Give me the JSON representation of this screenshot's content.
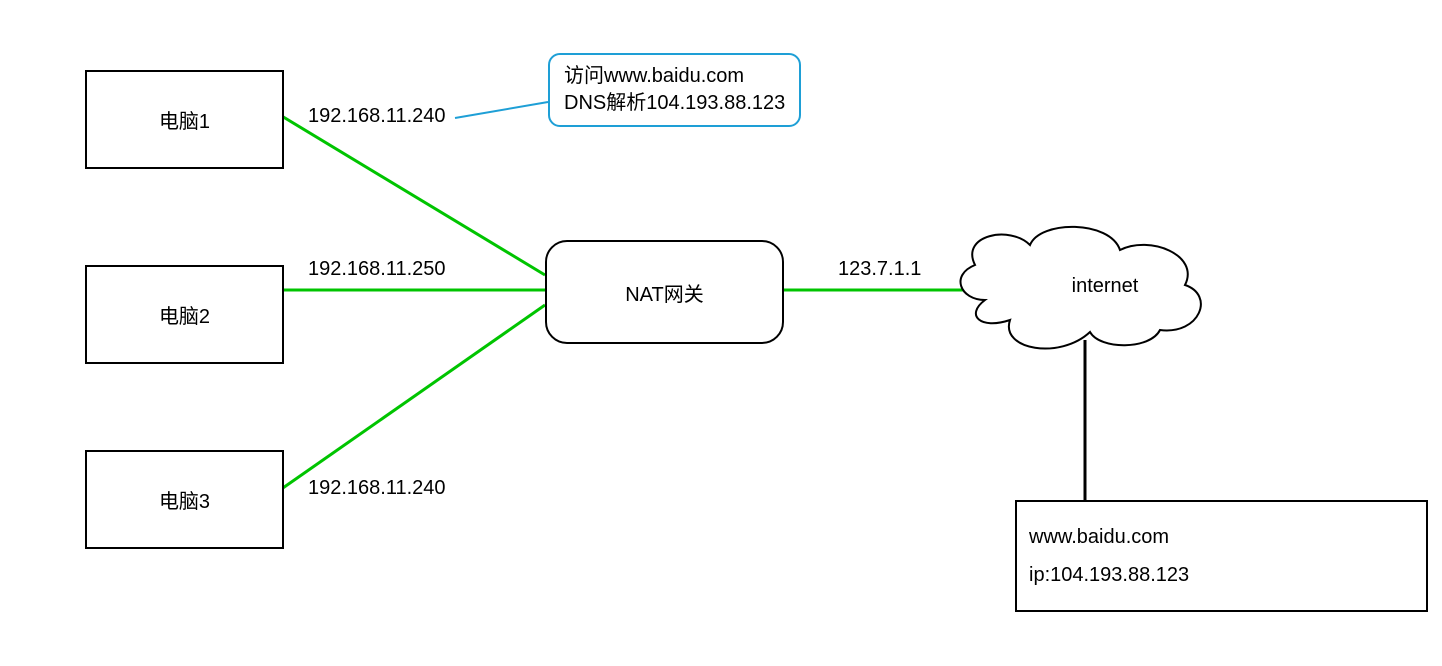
{
  "nodes": {
    "pc1": "电脑1",
    "pc2": "电脑2",
    "pc3": "电脑3",
    "nat": "NAT网关",
    "cloud": "internet"
  },
  "ips": {
    "pc1": "192.168.11.240",
    "pc2": "192.168.11.250",
    "pc3": "192.168.11.240",
    "public": "123.7.1.1"
  },
  "callout": {
    "line1": "访问www.baidu.com",
    "line2": "DNS解析104.193.88.123"
  },
  "server": {
    "domain": "www.baidu.com",
    "ip_label": "ip:",
    "ip_value": "104.193.88.123"
  },
  "colors": {
    "link": "#00c400",
    "callout_border": "#1e9fd6",
    "stroke": "#000000"
  }
}
